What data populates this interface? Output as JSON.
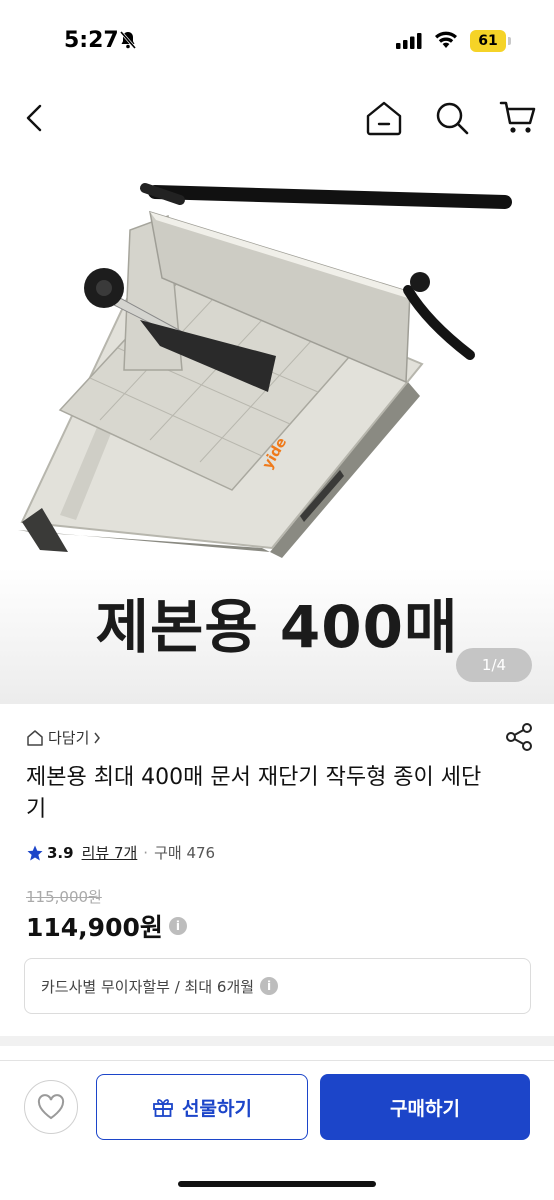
{
  "status_bar": {
    "time": "5:27",
    "battery": "61"
  },
  "product_image": {
    "caption": "제본용 400매",
    "page_indicator": "1/4"
  },
  "save": {
    "label": "다담기"
  },
  "product": {
    "title": "제본용 최대 400매 문서 재단기 작두형 종이 세단기",
    "rating": "3.9",
    "reviews": "리뷰 7개",
    "purchases": "구매 476",
    "original_price": "115,000원",
    "sale_price": "114,900원"
  },
  "installment": {
    "text": "카드사별 무이자할부 / 최대 6개월"
  },
  "bottom_bar": {
    "gift_label": "선물하기",
    "buy_label": "구매하기"
  },
  "colors": {
    "accent": "#1c45c9",
    "rating_star": "#1c45c9",
    "battery": "#f5d327"
  },
  "icons": [
    "bell-slash-icon",
    "signal-icon",
    "wifi-icon",
    "back-icon",
    "home-icon",
    "search-icon",
    "cart-icon",
    "save-home-icon",
    "chevron-right-icon",
    "share-icon",
    "star-icon",
    "info-icon",
    "heart-icon",
    "gift-icon"
  ]
}
